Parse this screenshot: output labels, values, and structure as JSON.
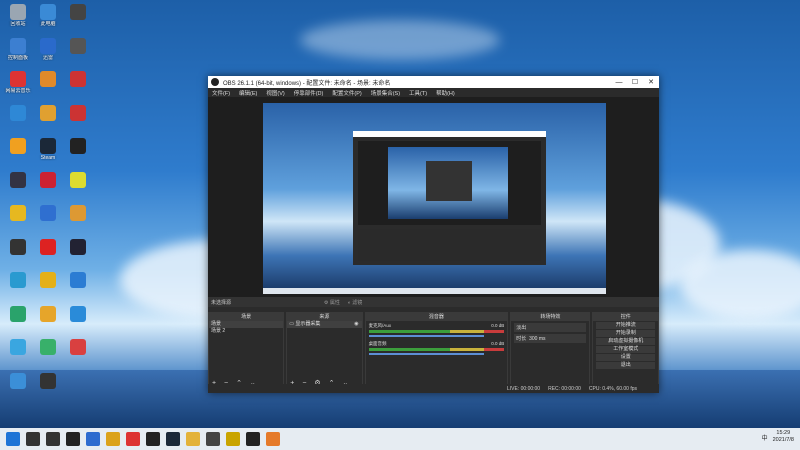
{
  "desktop_icons": [
    {
      "label": "回收站",
      "color": "#9aa6b2"
    },
    {
      "label": "此电脑",
      "color": "#3a8ad6"
    },
    {
      "label": "",
      "color": "#444"
    },
    {
      "label": "控制面板",
      "color": "#3c7fd1"
    },
    {
      "label": "迅雷",
      "color": "#2a6acb"
    },
    {
      "label": "",
      "color": "#555"
    },
    {
      "label": "网易云音乐",
      "color": "#d33"
    },
    {
      "label": "",
      "color": "#e08a2a"
    },
    {
      "label": "",
      "color": "#c33"
    },
    {
      "label": "",
      "color": "#2e88d6"
    },
    {
      "label": "",
      "color": "#e0a030"
    },
    {
      "label": "",
      "color": "#c33"
    },
    {
      "label": "",
      "color": "#f0a020"
    },
    {
      "label": "Steam",
      "color": "#1b2838"
    },
    {
      "label": "",
      "color": "#222"
    },
    {
      "label": "",
      "color": "#334"
    },
    {
      "label": "",
      "color": "#c23"
    },
    {
      "label": "",
      "color": "#dcdc30"
    },
    {
      "label": "",
      "color": "#e6b820"
    },
    {
      "label": "",
      "color": "#2f6fd0"
    },
    {
      "label": "",
      "color": "#d93"
    },
    {
      "label": "",
      "color": "#333"
    },
    {
      "label": "",
      "color": "#d22"
    },
    {
      "label": "",
      "color": "#223"
    },
    {
      "label": "",
      "color": "#2a9ad0"
    },
    {
      "label": "",
      "color": "#e4b018"
    },
    {
      "label": "",
      "color": "#2b7cd3"
    },
    {
      "label": "",
      "color": "#2aa36b"
    },
    {
      "label": "",
      "color": "#e6a52a"
    },
    {
      "label": "",
      "color": "#2a8bd9"
    },
    {
      "label": "",
      "color": "#3aa6e0"
    },
    {
      "label": "",
      "color": "#38b06a"
    },
    {
      "label": "",
      "color": "#d94040"
    },
    {
      "label": "",
      "color": "#3b8fd8"
    },
    {
      "label": "",
      "color": "#333"
    }
  ],
  "window": {
    "title": "OBS 26.1.1 (64-bit, windows) - 配置文件: 未命名 - 场景: 未命名",
    "minimize": "—",
    "maximize": "☐",
    "close": "✕"
  },
  "menu": [
    "文件(F)",
    "编辑(E)",
    "视图(V)",
    "停靠部件(D)",
    "配置文件(P)",
    "场景集合(S)",
    "工具(T)",
    "帮助(H)"
  ],
  "context_bar": {
    "no_source": "未选择源",
    "properties": "⚙ 属性",
    "filters": "◐ 滤镜"
  },
  "docks": {
    "scenes": {
      "title": "场景",
      "items": [
        "场景",
        "场景 2"
      ],
      "footer": "+ − ⌃ ⌄"
    },
    "sources": {
      "title": "来源",
      "items": [
        "显示器采集"
      ],
      "footer": "+ − ⚙ ⌃ ⌄"
    },
    "mixer": {
      "title": "混音器",
      "channels": [
        {
          "name": "麦克风/Aux",
          "level": "0.0 dB"
        },
        {
          "name": "桌面音频",
          "level": "0.0 dB"
        }
      ]
    },
    "transitions": {
      "title": "转场特效",
      "type": "淡出",
      "duration_label": "时长",
      "duration_value": "300 ms"
    },
    "controls": {
      "title": "控件",
      "buttons": [
        "开始推流",
        "开始录制",
        "启动虚拟摄像机",
        "工作室模式",
        "设置",
        "退出"
      ]
    }
  },
  "status": {
    "live": "LIVE: 00:00:00",
    "rec": "REC: 00:00:00",
    "cpu": "CPU: 0.4%, 60.00 fps"
  },
  "taskbar": {
    "icons": [
      "windows-logo",
      "search",
      "task-view",
      "app-s",
      "app-b",
      "app-chrome",
      "app-netease",
      "app-tx",
      "app-steam",
      "app-files",
      "app-w",
      "app-g",
      "app-obs",
      "app-orange"
    ],
    "icon_colors": [
      "#1e74d6",
      "#333",
      "#333",
      "#222",
      "#2d6bcf",
      "#dba21b",
      "#d33",
      "#222",
      "#1b2838",
      "#e3b23a",
      "#444",
      "#c9a400",
      "#222",
      "#e57a2a"
    ],
    "time": "15:29",
    "date": "2021/7/8",
    "lang": "中"
  }
}
